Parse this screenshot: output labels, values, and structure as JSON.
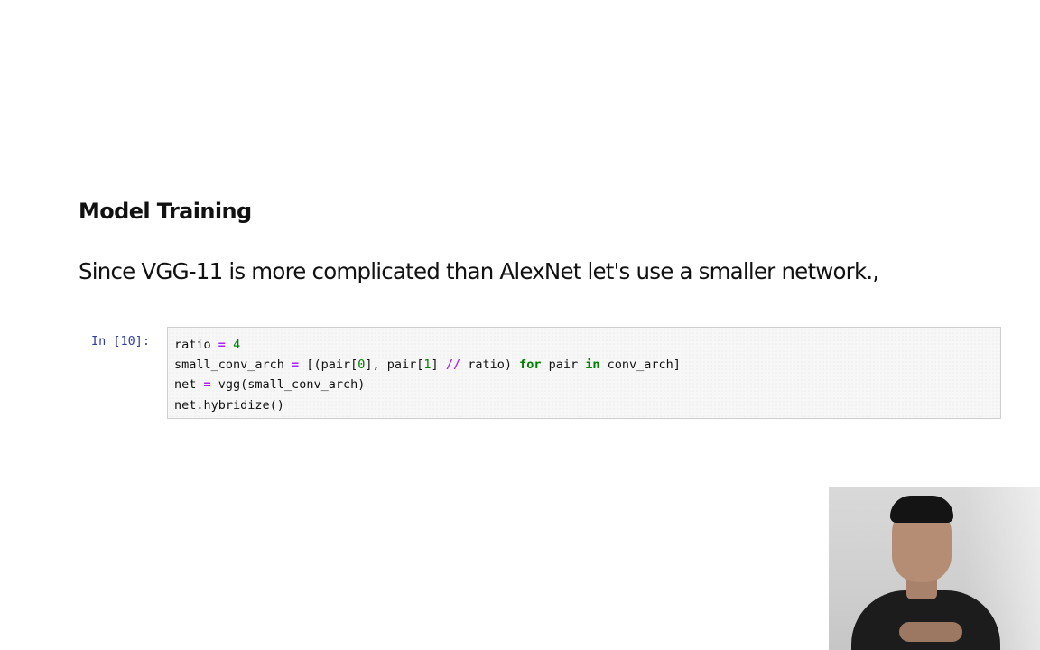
{
  "notebook": {
    "heading": "Model Training",
    "paragraph": "Since VGG-11 is more complicated than AlexNet let's use a smaller network.,"
  },
  "cell": {
    "prompt": "In [10]:",
    "lines": [
      [
        {
          "t": "ratio ",
          "c": "pn"
        },
        {
          "t": "=",
          "c": "op"
        },
        {
          "t": " ",
          "c": "pn"
        },
        {
          "t": "4",
          "c": "num"
        }
      ],
      [
        {
          "t": "small_conv_arch ",
          "c": "pn"
        },
        {
          "t": "=",
          "c": "op"
        },
        {
          "t": " [(pair[",
          "c": "pn"
        },
        {
          "t": "0",
          "c": "num"
        },
        {
          "t": "], pair[",
          "c": "pn"
        },
        {
          "t": "1",
          "c": "num"
        },
        {
          "t": "] ",
          "c": "pn"
        },
        {
          "t": "//",
          "c": "op"
        },
        {
          "t": " ratio) ",
          "c": "pn"
        },
        {
          "t": "for",
          "c": "kw"
        },
        {
          "t": " pair ",
          "c": "pn"
        },
        {
          "t": "in",
          "c": "kw"
        },
        {
          "t": " conv_arch]",
          "c": "pn"
        }
      ],
      [
        {
          "t": "net ",
          "c": "pn"
        },
        {
          "t": "=",
          "c": "op"
        },
        {
          "t": " vgg(small_conv_arch)",
          "c": "pn"
        }
      ],
      [
        {
          "t": "net.hybridize()",
          "c": "pn"
        }
      ]
    ]
  },
  "colors": {
    "prompt": "#303f9f",
    "operator": "#aa22ff",
    "number": "#008000",
    "keyword": "#008000",
    "cell_background": "#f7f7f7",
    "cell_border": "#cfcfcf"
  },
  "video": {
    "icon": "presenter-webcam-icon"
  }
}
